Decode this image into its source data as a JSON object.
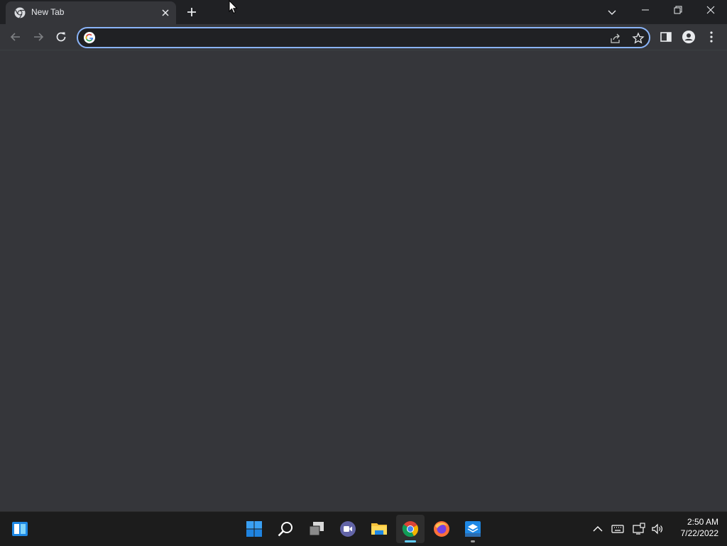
{
  "browser": {
    "tab": {
      "title": "New Tab",
      "favicon": "chrome-icon"
    },
    "omnibox": {
      "value": "",
      "placeholder": ""
    }
  },
  "taskbar": {
    "apps": [
      "widgets",
      "start",
      "search",
      "task-view",
      "teams-chat",
      "file-explorer",
      "chrome",
      "firefox",
      "store"
    ],
    "clock": {
      "time": "2:50 AM",
      "date": "7/22/2022"
    }
  },
  "colors": {
    "tab_bg": "#35363a",
    "titlebar_bg": "#202124",
    "accent": "#8ab4f8",
    "taskbar_bg": "#1c1c1c"
  }
}
